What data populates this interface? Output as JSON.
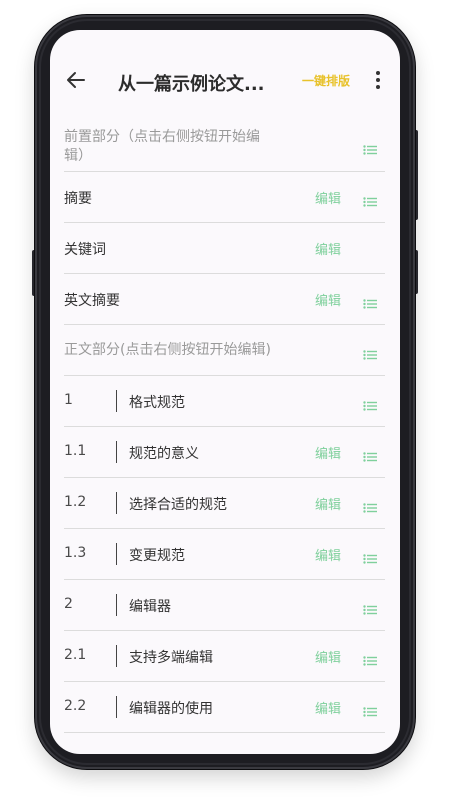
{
  "header": {
    "title": "从一篇示例论文...",
    "action": "一键排版"
  },
  "sections": [
    {
      "text": "前置部分（点击右侧按钮开始编辑）",
      "type": "section",
      "edit": null
    },
    {
      "text": "摘要",
      "type": "item",
      "edit": "编辑"
    },
    {
      "text": "关键词",
      "type": "item",
      "edit": "编辑"
    },
    {
      "text": "英文摘要",
      "type": "item",
      "edit": "编辑"
    },
    {
      "text": "正文部分(点击右侧按钮开始编辑)",
      "type": "section",
      "edit": null
    }
  ],
  "outline": [
    {
      "num": "1",
      "heading": "格式规范",
      "edit": null
    },
    {
      "num": "1.1",
      "heading": "规范的意义",
      "edit": "编辑"
    },
    {
      "num": "1.2",
      "heading": "选择合适的规范",
      "edit": "编辑"
    },
    {
      "num": "1.3",
      "heading": "变更规范",
      "edit": "编辑"
    },
    {
      "num": "2",
      "heading": "编辑器",
      "edit": null
    },
    {
      "num": "2.1",
      "heading": "支持多端编辑",
      "edit": "编辑"
    },
    {
      "num": "2.2",
      "heading": "编辑器的使用",
      "edit": "编辑"
    }
  ],
  "colors": {
    "accent": "#e8c22b",
    "edit": "#7fd09c",
    "section_text": "#9a9a9a"
  },
  "icons": {
    "back": "arrow-left-icon",
    "more": "more-vertical-icon",
    "list": "list-icon"
  }
}
